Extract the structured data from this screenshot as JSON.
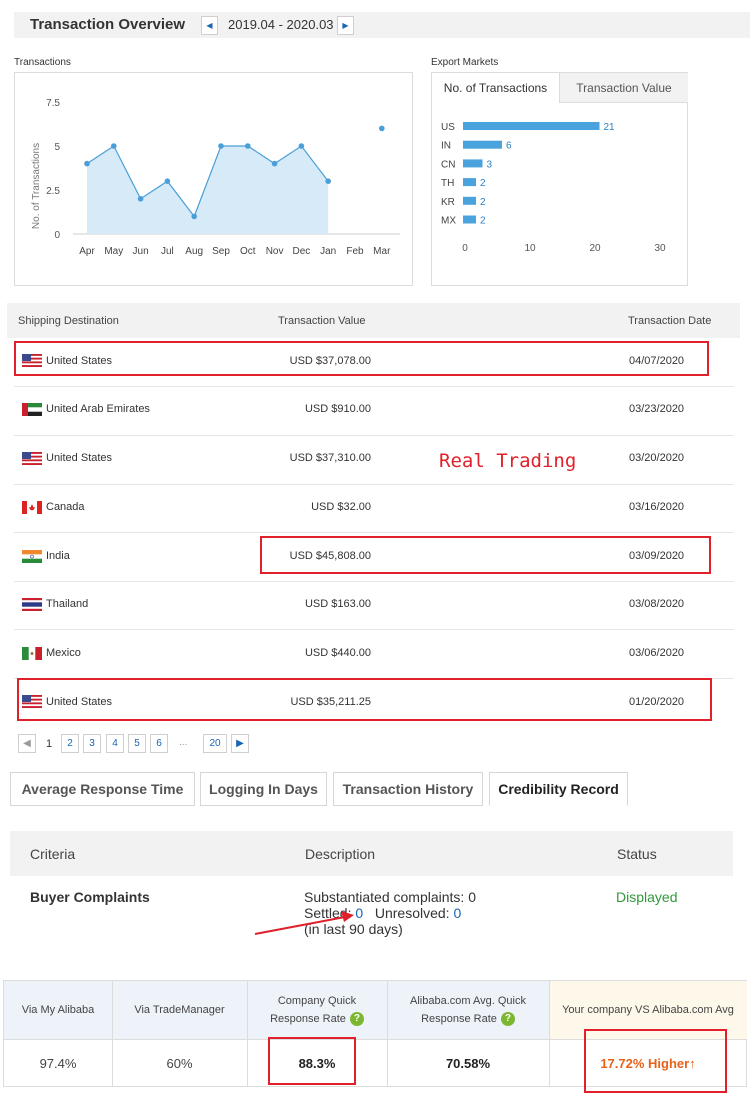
{
  "header": {
    "title": "Transaction Overview",
    "date_range": "2019.04 - 2020.03"
  },
  "transactions_chart": {
    "label": "Transactions",
    "chart_data": {
      "type": "area",
      "categories": [
        "Apr",
        "May",
        "Jun",
        "Jul",
        "Aug",
        "Sep",
        "Oct",
        "Nov",
        "Dec",
        "Jan",
        "Feb",
        "Mar"
      ],
      "values": [
        4,
        5,
        2,
        3,
        1,
        5,
        5,
        4,
        5,
        3,
        null,
        6
      ],
      "ylabel": "No. of Transactions",
      "yticks": [
        "0",
        "2.5",
        "5",
        "7.5"
      ],
      "ylim": [
        0,
        7.5
      ],
      "color": "#4a9fd8"
    }
  },
  "export_markets": {
    "label": "Export Markets",
    "tabs": [
      "No. of Transactions",
      "Transaction Value"
    ],
    "chart_data": {
      "type": "bar",
      "orientation": "horizontal",
      "categories": [
        "US",
        "IN",
        "CN",
        "TH",
        "KR",
        "MX"
      ],
      "values": [
        21,
        6,
        3,
        2,
        2,
        2
      ],
      "xticks": [
        "0",
        "10",
        "20",
        "30"
      ],
      "xlim": [
        0,
        30
      ],
      "color": "#4aa3dc"
    }
  },
  "table": {
    "headers": [
      "Shipping Destination",
      "Transaction Value",
      "Transaction Date"
    ],
    "rows": [
      {
        "country": "United States",
        "value": "USD $37,078.00",
        "date": "04/07/2020"
      },
      {
        "country": "United Arab Emirates",
        "value": "USD $910.00",
        "date": "03/23/2020"
      },
      {
        "country": "United States",
        "value": "USD $37,310.00",
        "date": "03/20/2020"
      },
      {
        "country": "Canada",
        "value": "USD $32.00",
        "date": "03/16/2020"
      },
      {
        "country": "India",
        "value": "USD $45,808.00",
        "date": "03/09/2020"
      },
      {
        "country": "Thailand",
        "value": "USD $163.00",
        "date": "03/08/2020"
      },
      {
        "country": "Mexico",
        "value": "USD $440.00",
        "date": "03/06/2020"
      },
      {
        "country": "United States",
        "value": "USD $35,211.25",
        "date": "01/20/2020"
      }
    ],
    "annotation": "Real Trading"
  },
  "pagination": {
    "pages": [
      "1",
      "2",
      "3",
      "4",
      "5",
      "6"
    ],
    "ellipsis": "...",
    "last": "20"
  },
  "tabs": [
    "Average Response Time",
    "Logging In Days",
    "Transaction History",
    "Credibility Record"
  ],
  "credibility": {
    "headers": [
      "Criteria",
      "Description",
      "Status"
    ],
    "criteria": "Buyer Complaints",
    "desc_line1": "Substantiated complaints: 0",
    "settled_label": "Settled:",
    "settled_value": "0",
    "unresolved_label": "Unresolved:",
    "unresolved_value": "0",
    "desc_line3": "(in last 90 days)",
    "status": "Displayed"
  },
  "response": {
    "headers": [
      "Via My Alibaba",
      "Via TradeManager",
      "Company Quick Response Rate",
      "Alibaba.com Avg. Quick Response Rate",
      "Your company VS Alibaba.com Avg"
    ],
    "values": [
      "97.4%",
      "60%",
      "88.3%",
      "70.58%",
      "17.72% Higher↑"
    ],
    "help_icon": "?"
  }
}
